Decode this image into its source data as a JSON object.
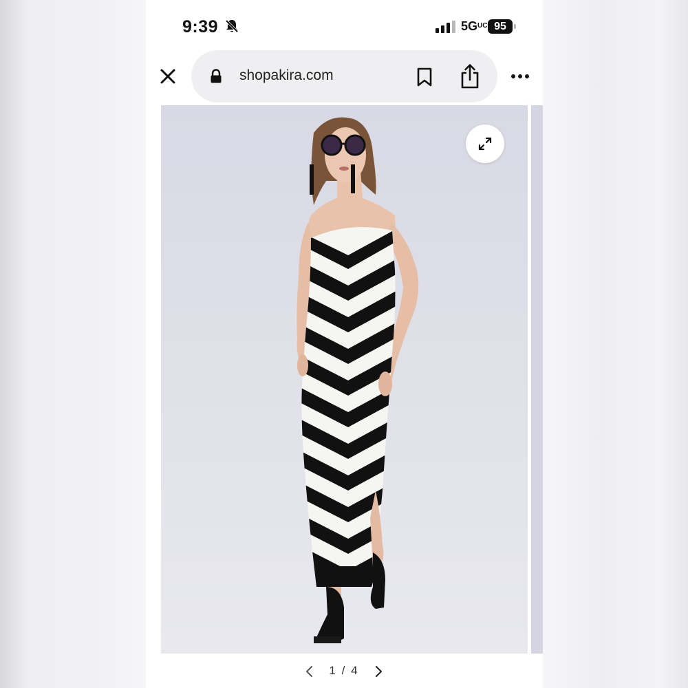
{
  "status_bar": {
    "time": "9:39",
    "network": "5G",
    "network_suffix": "UC",
    "battery": "95"
  },
  "browser": {
    "url": "shopakira.com",
    "icons": [
      "close-icon",
      "lock-icon",
      "bookmark-icon",
      "share-icon",
      "more-icon"
    ]
  },
  "product_image": {
    "subject": "model in strapless black and white chevron stripe maxi dress",
    "expand_icon": "expand-icon"
  },
  "pager": {
    "current": "1",
    "separator": "/",
    "total": "4",
    "prev_icon": "chevron-left-icon",
    "next_icon": "chevron-right-icon"
  },
  "colors": {
    "image_background": "#dedee8",
    "stripe_dark": "#111111",
    "stripe_light": "#f5f5f2",
    "url_bar": "#efeff1"
  }
}
